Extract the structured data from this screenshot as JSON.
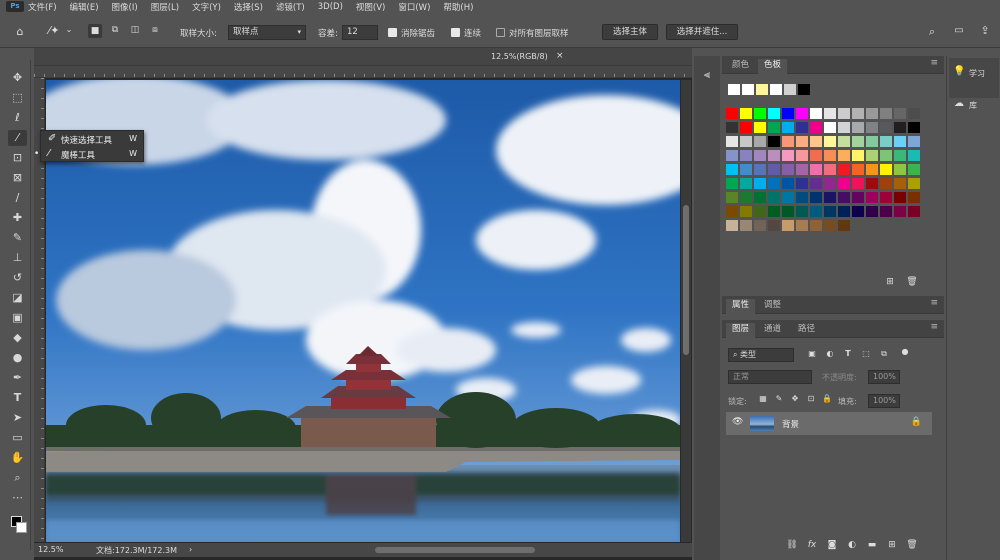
{
  "menubar": {
    "logo": "Ps",
    "items": [
      "文件(F)",
      "编辑(E)",
      "图像(I)",
      "图层(L)",
      "文字(Y)",
      "选择(S)",
      "滤镜(T)",
      "3D(D)",
      "视图(V)",
      "窗口(W)",
      "帮助(H)"
    ]
  },
  "options": {
    "sample_size_label": "取样大小:",
    "sample_size_value": "取样点",
    "tolerance_label": "容差:",
    "tolerance_value": "12",
    "antialias_label": "消除锯齿",
    "contiguous_label": "连续",
    "sample_all_label": "对所有图层取样",
    "select_subject_label": "选择主体",
    "select_mask_label": "选择并遮住..."
  },
  "document": {
    "tab_title": "12.5%(RGB/8)",
    "tab_close": "×",
    "zoom_status": "12.5%",
    "doc_status": "文档:172.3M/172.3M"
  },
  "flyout": {
    "items": [
      {
        "label": "快速选择工具",
        "key": "W",
        "icon": "quick-select-icon"
      },
      {
        "label": "魔棒工具",
        "key": "W",
        "icon": "magic-wand-icon",
        "active": true
      }
    ]
  },
  "swatches_panel": {
    "tabs": [
      "颜色",
      "色板"
    ],
    "active_tab": "色板",
    "recent": [
      "#ffffff",
      "#ffffff",
      "#fdf59b",
      "#ffffff",
      "#d0d0d0",
      "#000000"
    ],
    "grid": [
      [
        "#ff0000",
        "#ffff00",
        "#00ff00",
        "#00ffff",
        "#0000ff",
        "#ff00ff",
        "#ffffff",
        "#e5e5e5",
        "#cccccc",
        "#b2b2b2",
        "#999999",
        "#808080",
        "#666666",
        "#4d4d4d"
      ],
      [
        "#333333",
        "#ff0000",
        "#ffff00",
        "#00a651",
        "#00aeef",
        "#2e3192",
        "#ec008c",
        "#ffffff",
        "#d1d3d4",
        "#a7a9ac",
        "#808285",
        "#58595b",
        "#231f20",
        "#000000"
      ],
      [
        "#e6e6e6",
        "#c7c7c7",
        "#a8a8a8",
        "#000000",
        "#f7977a",
        "#f9ad81",
        "#fdc68a",
        "#fff79a",
        "#c4df9b",
        "#a2d39c",
        "#82ca9d",
        "#7bcdc8",
        "#6ecff6",
        "#7ea7d8"
      ],
      [
        "#8493ca",
        "#8882be",
        "#a187be",
        "#bc8dbf",
        "#f49ac2",
        "#f6989d",
        "#f26c4f",
        "#f68e55",
        "#fbaf5d",
        "#fff467",
        "#acd372",
        "#7cc576",
        "#3bb878",
        "#1abbb4"
      ],
      [
        "#00bff3",
        "#438ccb",
        "#5574b9",
        "#605ca8",
        "#855fa8",
        "#a763a8",
        "#f06ea9",
        "#f26d7d",
        "#ed1c24",
        "#f26522",
        "#f7941d",
        "#fff200",
        "#8dc63f",
        "#39b54a"
      ],
      [
        "#00a651",
        "#00a99d",
        "#00aeef",
        "#0072bc",
        "#0054a6",
        "#2e3192",
        "#662d91",
        "#92278f",
        "#ec008c",
        "#ed145b",
        "#9e0b0f",
        "#a0410d",
        "#a36209",
        "#aba000"
      ],
      [
        "#598527",
        "#1a7b30",
        "#007236",
        "#00746b",
        "#0076a3",
        "#004b80",
        "#003471",
        "#1b1464",
        "#440e62",
        "#630460",
        "#9e005d",
        "#9e0039",
        "#790000",
        "#7b2e00"
      ],
      [
        "#7d4900",
        "#827b00",
        "#406618",
        "#005e20",
        "#005826",
        "#005952",
        "#005b7f",
        "#003663",
        "#002157",
        "#0d004c",
        "#32004b",
        "#4b0049",
        "#7b0046",
        "#7a0026"
      ],
      [
        "#c7b299",
        "#998675",
        "#736357",
        "#534741",
        "#c69c6d",
        "#a67c52",
        "#8c6239",
        "#754c24",
        "#603913"
      ]
    ]
  },
  "properties_panel": {
    "tabs": [
      "属性",
      "调整"
    ]
  },
  "layers_panel": {
    "tabs": [
      "图层",
      "通道",
      "路径"
    ],
    "filter_label": "类型",
    "blend_mode": "正常",
    "opacity_label": "不透明度:",
    "opacity_value": "100%",
    "lock_label": "锁定:",
    "fill_label": "填充:",
    "fill_value": "100%",
    "layers": [
      {
        "name": "背景",
        "visible": true,
        "locked": true
      }
    ]
  },
  "far_right": {
    "items": [
      {
        "label": "学习",
        "icon": "lightbulb-icon"
      },
      {
        "label": "库",
        "icon": "libraries-icon"
      }
    ]
  }
}
